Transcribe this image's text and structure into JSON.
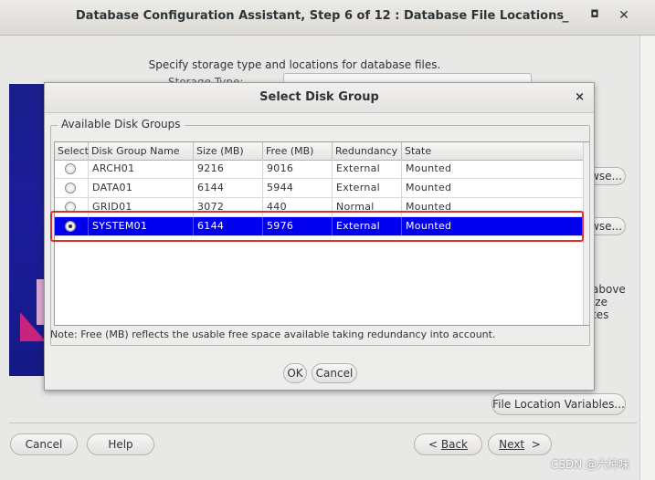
{
  "window": {
    "title": "Database Configuration Assistant, Step 6 of 12 : Database File Locations",
    "minimize": "_",
    "maximize": "◘",
    "close": "✕"
  },
  "main": {
    "instruction": "Specify storage type and locations for database files.",
    "storage_type_label": "Storage Type:",
    "browse_label_1": "wse...",
    "browse_label_2": "wse...",
    "side_text": [
      "above",
      "ize",
      "tes"
    ],
    "file_location_variables": "File Location Variables...",
    "cancel": "Cancel",
    "help": "Help",
    "back": "Back",
    "next": "Next"
  },
  "dialog": {
    "title": "Select Disk Group",
    "close": "×",
    "group_label": "Available Disk Groups",
    "columns": [
      "Select",
      "Disk Group Name",
      "Size (MB)",
      "Free (MB)",
      "Redundancy",
      "State"
    ],
    "rows": [
      {
        "name": "ARCH01",
        "size": "9216",
        "free": "9016",
        "redundancy": "External",
        "state": "Mounted",
        "selected": false
      },
      {
        "name": "DATA01",
        "size": "6144",
        "free": "5944",
        "redundancy": "External",
        "state": "Mounted",
        "selected": false
      },
      {
        "name": "GRID01",
        "size": "3072",
        "free": "440",
        "redundancy": "Normal",
        "state": "Mounted",
        "selected": false
      },
      {
        "name": "SYSTEM01",
        "size": "6144",
        "free": "5976",
        "redundancy": "External",
        "state": "Mounted",
        "selected": true
      }
    ],
    "note": "Note:  Free (MB) reflects the usable free space available taking redundancy into account.",
    "ok": "OK",
    "cancel": "Cancel"
  },
  "watermark": "CSDN @六种味",
  "colors": {
    "selection": "#0000ee",
    "highlight_box": "#e0302b",
    "sidebar_art": "#1c1c9b"
  }
}
